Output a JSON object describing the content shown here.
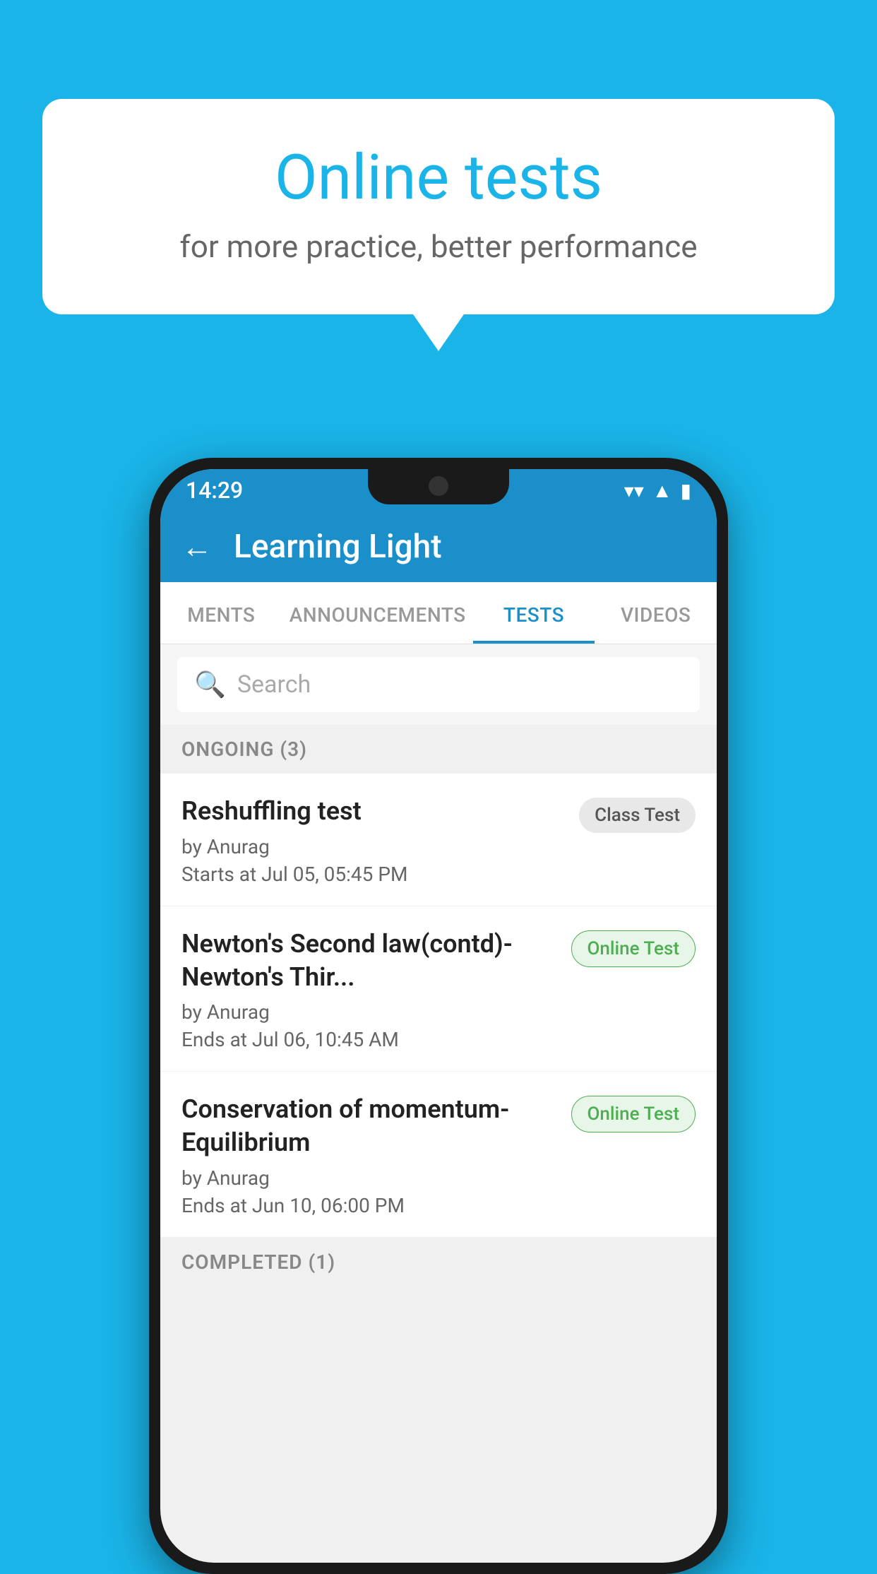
{
  "background_color": "#1ab4e8",
  "speech_bubble": {
    "title": "Online tests",
    "subtitle": "for more practice, better performance"
  },
  "phone": {
    "status_bar": {
      "time": "14:29",
      "wifi": "▼",
      "signal": "▲",
      "battery": "█"
    },
    "app_bar": {
      "title": "Learning Light",
      "back_label": "←"
    },
    "tabs": [
      {
        "label": "MENTS",
        "active": false
      },
      {
        "label": "ANNOUNCEMENTS",
        "active": false
      },
      {
        "label": "TESTS",
        "active": true
      },
      {
        "label": "VIDEOS",
        "active": false
      }
    ],
    "search": {
      "placeholder": "Search"
    },
    "ongoing_section": {
      "label": "ONGOING (3)"
    },
    "test_items": [
      {
        "name": "Reshuffling test",
        "by": "by Anurag",
        "date": "Starts at  Jul 05, 05:45 PM",
        "badge": "Class Test",
        "badge_type": "class"
      },
      {
        "name": "Newton's Second law(contd)-Newton's Thir...",
        "by": "by Anurag",
        "date": "Ends at  Jul 06, 10:45 AM",
        "badge": "Online Test",
        "badge_type": "online"
      },
      {
        "name": "Conservation of momentum-Equilibrium",
        "by": "by Anurag",
        "date": "Ends at  Jun 10, 06:00 PM",
        "badge": "Online Test",
        "badge_type": "online"
      }
    ],
    "completed_section": {
      "label": "COMPLETED (1)"
    }
  }
}
